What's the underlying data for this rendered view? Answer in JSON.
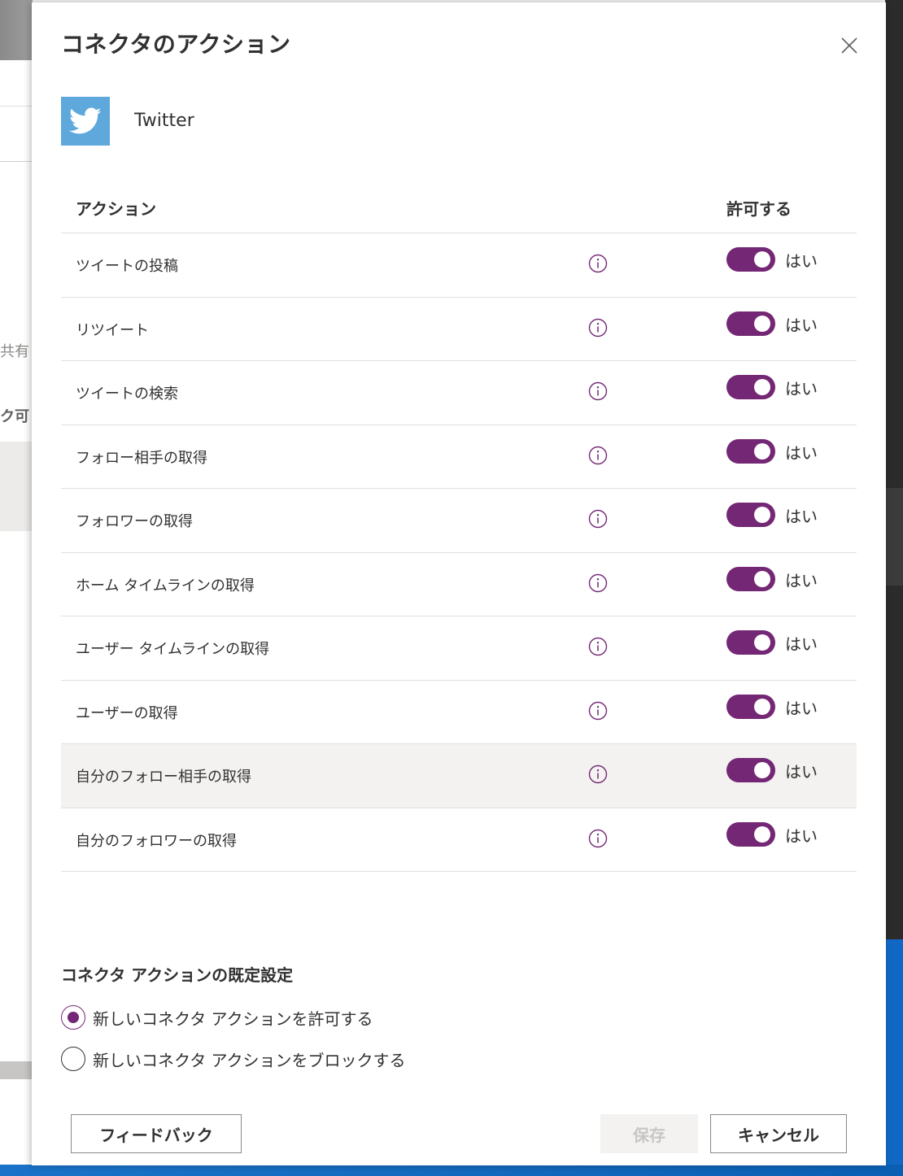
{
  "background": {
    "text_shared": "共有",
    "text_partial": "ク可"
  },
  "dialog": {
    "title": "コネクタのアクション",
    "close_icon": "close-icon",
    "connector": {
      "name": "Twitter",
      "logo_icon": "twitter-bird-icon",
      "logo_color": "#5ea8dc"
    },
    "table": {
      "column_action": "アクション",
      "column_allow": "許可する",
      "rows": [
        {
          "label": "ツイートの投稿",
          "allowed": true,
          "state_text": "はい"
        },
        {
          "label": "リツイート",
          "allowed": true,
          "state_text": "はい"
        },
        {
          "label": "ツイートの検索",
          "allowed": true,
          "state_text": "はい"
        },
        {
          "label": "フォロー相手の取得",
          "allowed": true,
          "state_text": "はい"
        },
        {
          "label": "フォロワーの取得",
          "allowed": true,
          "state_text": "はい"
        },
        {
          "label": "ホーム タイムラインの取得",
          "allowed": true,
          "state_text": "はい"
        },
        {
          "label": "ユーザー タイムラインの取得",
          "allowed": true,
          "state_text": "はい"
        },
        {
          "label": "ユーザーの取得",
          "allowed": true,
          "state_text": "はい"
        },
        {
          "label": "自分のフォロー相手の取得",
          "allowed": true,
          "state_text": "はい"
        },
        {
          "label": "自分のフォロワーの取得",
          "allowed": true,
          "state_text": "はい"
        }
      ]
    },
    "defaults": {
      "title": "コネクタ アクションの既定設定",
      "options": [
        {
          "label": "新しいコネクタ アクションを許可する",
          "checked": true
        },
        {
          "label": "新しいコネクタ アクションをブロックする",
          "checked": false
        }
      ]
    },
    "buttons": {
      "feedback": "フィードバック",
      "save": "保存",
      "cancel": "キャンセル"
    },
    "accent_color": "#742774"
  }
}
